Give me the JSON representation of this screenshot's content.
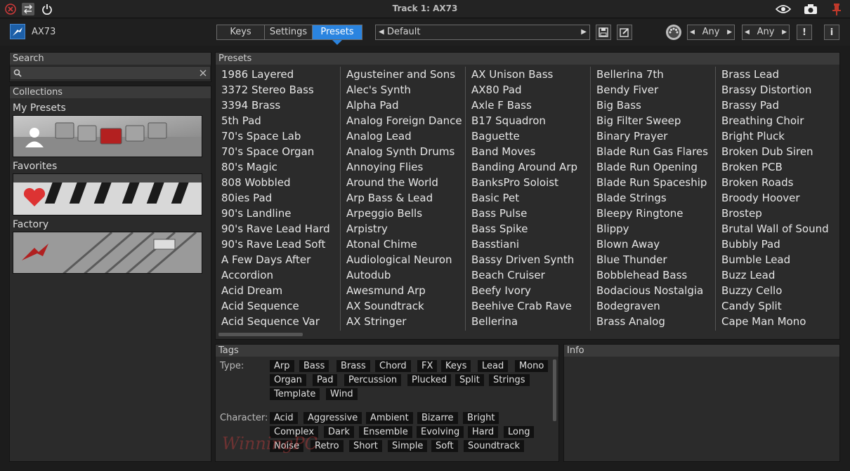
{
  "window": {
    "title": "Track 1: AX73",
    "close_icon": "close-icon",
    "swap_icon": "swap-icon",
    "power_icon": "power-icon",
    "eye_icon": "eye-icon",
    "camera_icon": "camera-icon",
    "pin_icon": "pin-icon"
  },
  "toolbar": {
    "brand": "AX73",
    "tabs": [
      {
        "label": "Keys"
      },
      {
        "label": "Settings"
      },
      {
        "label": "Presets",
        "active": true
      }
    ],
    "preset_value": "Default",
    "any1": "Any",
    "any2": "Any",
    "warn_label": "!",
    "info_label": "i"
  },
  "search": {
    "header": "Search",
    "value": "",
    "placeholder": ""
  },
  "collections": {
    "header": "Collections",
    "items": [
      {
        "label": "My Presets"
      },
      {
        "label": "Favorites"
      },
      {
        "label": "Factory"
      }
    ]
  },
  "presets": {
    "header": "Presets",
    "columns": [
      [
        "1986 Layered",
        "3372 Stereo Bass",
        "3394 Brass",
        "5th Pad",
        "70's Space Lab",
        "70's Space Organ",
        "80's Magic",
        "808 Wobbled",
        "80ies Pad",
        "90's Landline",
        "90's Rave Lead Hard",
        "90's Rave Lead Soft",
        "A Few Days After",
        "Accordion",
        "Acid Dream",
        "Acid Sequence",
        "Acid Sequence Var"
      ],
      [
        "Agusteiner and Sons",
        "Alec's Synth",
        "Alpha Pad",
        "Analog Foreign Dance",
        "Analog Lead",
        "Analog Synth Drums",
        "Annoying Flies",
        "Around the World",
        "Arp Bass & Lead",
        "Arpeggio Bells",
        "Arpistry",
        "Atonal Chime",
        "Audiological Neuron",
        "Autodub",
        "Awesmund Arp",
        "AX Soundtrack",
        "AX Stringer"
      ],
      [
        "AX Unison Bass",
        "AX80 Pad",
        "Axle F Bass",
        "B17 Squadron",
        "Baguette",
        "Band Moves",
        "Banding Around Arp",
        "BanksPro Soloist",
        "Basic Pet",
        "Bass Pulse",
        "Bass Spike",
        "Basstiani",
        "Bassy Driven Synth",
        "Beach Cruiser",
        "Beefy Ivory",
        "Beehive Crab Rave",
        "Bellerina"
      ],
      [
        "Bellerina 7th",
        "Bendy Fiver",
        "Big Bass",
        "Big Filter Sweep",
        "Binary Prayer",
        "Blade Run Gas Flares",
        "Blade Run Opening",
        "Blade Run Spaceship",
        "Blade Strings",
        "Bleepy Ringtone",
        "Blippy",
        "Blown Away",
        "Blue Thunder",
        "Bobblehead Bass",
        "Bodacious Nostalgia",
        "Bodegraven",
        "Brass Analog"
      ],
      [
        "Brass Lead",
        "Brassy Distortion",
        "Brassy Pad",
        "Breathing Choir",
        "Bright Pluck",
        "Broken Dub Siren",
        "Broken PCB",
        "Broken Roads",
        "Broody Hoover",
        "Brostep",
        "Brutal Wall of Sound",
        "Bubbly Pad",
        "Bumble Lead",
        "Buzz Lead",
        "Buzzy Cello",
        "Candy Split",
        "Cape Man Mono"
      ]
    ]
  },
  "tags": {
    "header": "Tags",
    "type_label": "Type:",
    "character_label": "Character:",
    "type": [
      "Arp",
      "Bass",
      "Brass",
      "Chord",
      "FX",
      "Keys",
      "Lead",
      "Mono",
      "Organ",
      "Pad",
      "Percussion",
      "Plucked",
      "Split",
      "Strings",
      "Template",
      "Wind"
    ],
    "character": [
      "Acid",
      "Aggressive",
      "Ambient",
      "Bizarre",
      "Bright",
      "Complex",
      "Dark",
      "Ensemble",
      "Evolving",
      "Hard",
      "Long",
      "Noise",
      "Retro",
      "Short",
      "Simple",
      "Soft",
      "Soundtrack"
    ]
  },
  "info": {
    "header": "Info"
  },
  "watermark": "WinningPC",
  "colors": {
    "accent": "#2a84e0",
    "close_red": "#d23b3b",
    "pin_red": "#c0392b"
  }
}
